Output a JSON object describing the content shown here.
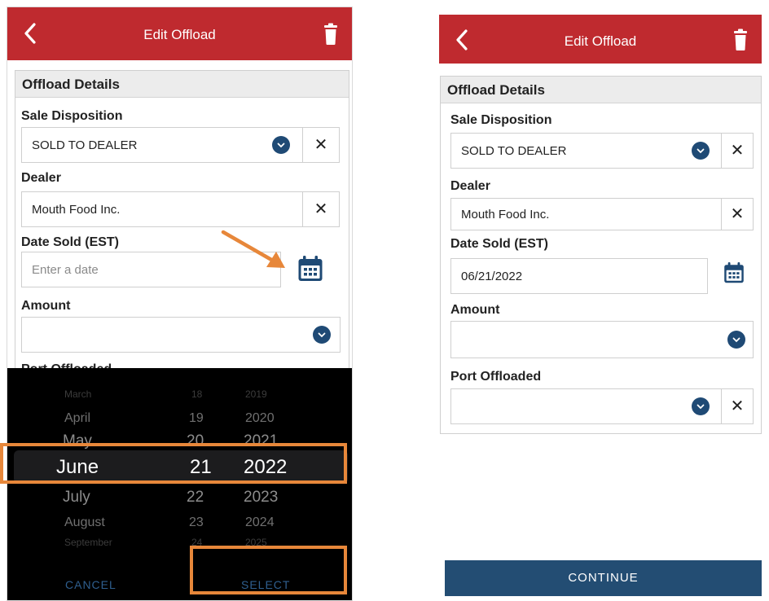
{
  "left_screen": {
    "header": {
      "title": "Edit Offload"
    },
    "panel": {
      "title": "Offload Details"
    },
    "sale_disposition": {
      "label": "Sale Disposition",
      "value": "SOLD TO DEALER"
    },
    "dealer": {
      "label": "Dealer",
      "value": "Mouth Food Inc."
    },
    "date_sold": {
      "label": "Date Sold (EST)",
      "placeholder": "Enter a date"
    },
    "amount": {
      "label": "Amount",
      "value": ""
    },
    "port": {
      "label": "Port Offloaded"
    },
    "picker": {
      "rows": [
        {
          "month": "March",
          "day": "18",
          "year": "2019"
        },
        {
          "month": "April",
          "day": "19",
          "year": "2020"
        },
        {
          "month": "May",
          "day": "20",
          "year": "2021"
        },
        {
          "month": "June",
          "day": "21",
          "year": "2022"
        },
        {
          "month": "July",
          "day": "22",
          "year": "2023"
        },
        {
          "month": "August",
          "day": "23",
          "year": "2024"
        },
        {
          "month": "September",
          "day": "24",
          "year": "2025"
        }
      ],
      "cancel_label": "CANCEL",
      "select_label": "SELECT"
    }
  },
  "right_screen": {
    "header": {
      "title": "Edit Offload"
    },
    "panel": {
      "title": "Offload Details"
    },
    "sale_disposition": {
      "label": "Sale Disposition",
      "value": "SOLD TO DEALER"
    },
    "dealer": {
      "label": "Dealer",
      "value": "Mouth Food Inc."
    },
    "date_sold": {
      "label": "Date Sold (EST)",
      "value": "06/21/2022"
    },
    "amount": {
      "label": "Amount",
      "value": ""
    },
    "port": {
      "label": "Port Offloaded",
      "value": ""
    },
    "continue_label": "CONTINUE"
  },
  "colors": {
    "header_red": "#bf2a2f",
    "navy": "#1f4a75",
    "annotation_orange": "#e7873a",
    "continue_blue": "#234d73"
  },
  "icons": {
    "back": "chevron-left-icon",
    "delete": "trash-icon",
    "dropdown": "chevron-down-icon",
    "clear": "close-icon",
    "calendar": "calendar-icon",
    "annotation": "arrow-icon"
  }
}
